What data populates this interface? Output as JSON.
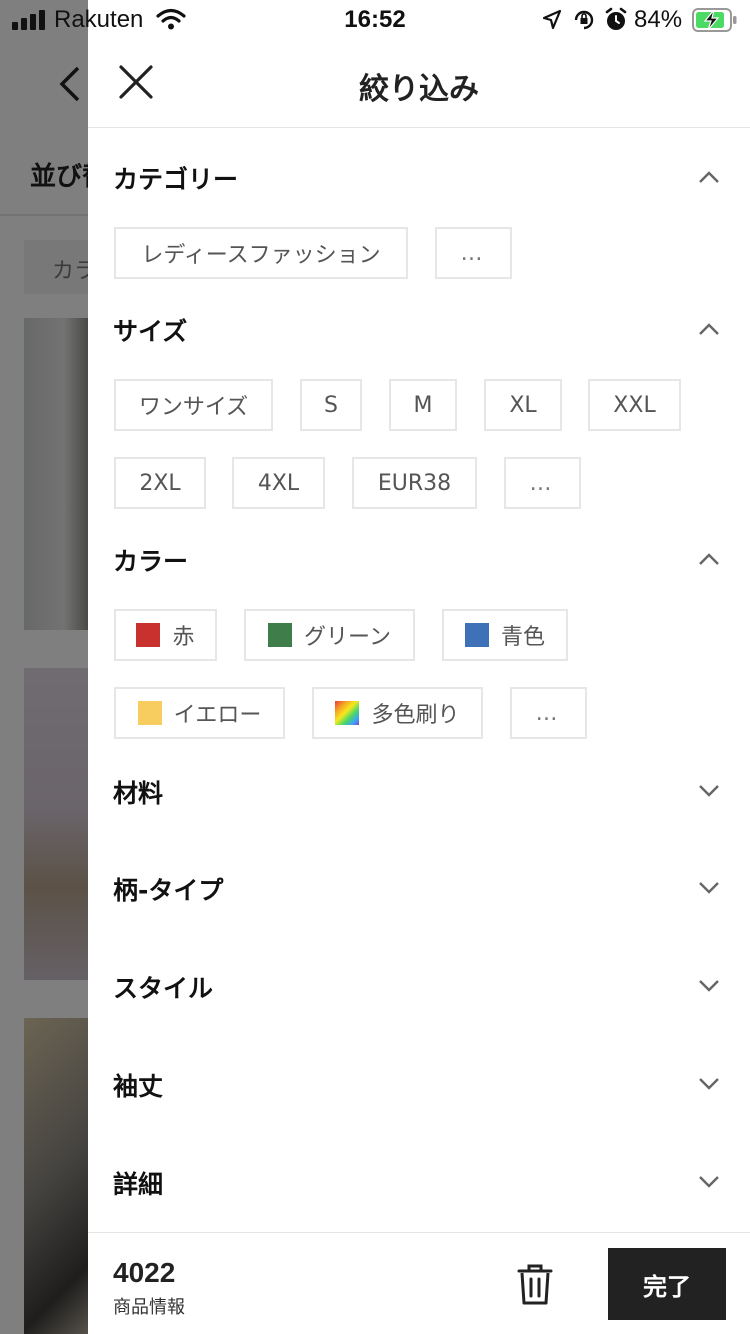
{
  "status_bar": {
    "carrier": "Rakuten",
    "time": "16:52",
    "battery_percent": "84%",
    "icons": [
      "signal-icon",
      "wifi-icon",
      "location-icon",
      "lock-rotation-icon",
      "alarm-icon",
      "battery-charging-icon"
    ]
  },
  "background": {
    "sort_label": "並び替",
    "chip_label": "カラ"
  },
  "drawer": {
    "title": "絞り込み",
    "close_icon": "close-icon",
    "sections": {
      "category": {
        "title": "カテゴリー",
        "expanded": true,
        "chips": [
          "レディースファッション",
          "…"
        ]
      },
      "size": {
        "title": "サイズ",
        "expanded": true,
        "chips": [
          "ワンサイズ",
          "S",
          "M",
          "XL",
          "XXL",
          "2XL",
          "4XL",
          "EUR38",
          "…"
        ]
      },
      "color": {
        "title": "カラー",
        "expanded": true,
        "chips": [
          {
            "label": "赤",
            "swatch": "#c8312e"
          },
          {
            "label": "グリーン",
            "swatch": "#3f7d4a"
          },
          {
            "label": "青色",
            "swatch": "#3f71b8"
          },
          {
            "label": "イエロー",
            "swatch": "#f7cd5f"
          },
          {
            "label": "多色刷り",
            "swatch": "multicolor"
          },
          {
            "label": "…"
          }
        ]
      },
      "material": {
        "title": "材料",
        "expanded": false
      },
      "pattern": {
        "title": "柄-タイプ",
        "expanded": false
      },
      "style": {
        "title": "スタイル",
        "expanded": false
      },
      "sleeve": {
        "title": "袖丈",
        "expanded": false
      },
      "details": {
        "title": "詳細",
        "expanded": false
      }
    },
    "footer": {
      "count": "4022",
      "count_caption": "商品情報",
      "trash_icon": "trash-icon",
      "done_label": "完了"
    }
  },
  "colors": {
    "accent_dark": "#222222",
    "chip_border": "#e6e6e6",
    "scrim": "rgba(0,0,0,0.5)"
  }
}
